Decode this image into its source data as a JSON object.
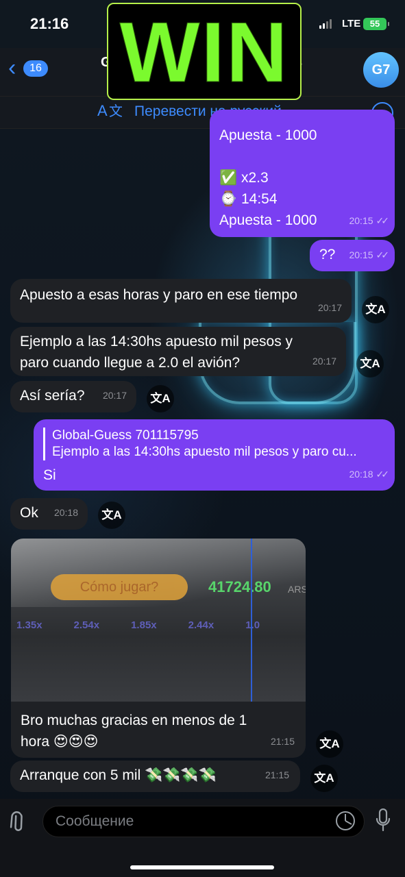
{
  "status": {
    "time": "21:16",
    "network": "LTE",
    "battery": "55"
  },
  "header": {
    "back_count": "16",
    "title_start": "G",
    "title_end": "s",
    "avatar": "G7",
    "overlay_text": "WIN"
  },
  "translate_bar": {
    "label": "Перевести на русский",
    "icon": "translate-icon"
  },
  "messages": [
    {
      "dir": "out",
      "lines": [
        "Apuesta - 1000",
        "",
        "✅ x2.3",
        "⌚ 14:54",
        "Apuesta - 1000"
      ],
      "time": "20:15"
    },
    {
      "dir": "out",
      "text": "??",
      "time": "20:15"
    },
    {
      "dir": "in",
      "text": "Apuesto a esas horas y paro en ese tiempo",
      "time": "20:17"
    },
    {
      "dir": "in",
      "text": "Ejemplo a las 14:30hs apuesto mil pesos y paro cuando llegue a 2.0 el avión?",
      "time": "20:17"
    },
    {
      "dir": "in",
      "text": "Así sería?",
      "time": "20:17"
    },
    {
      "dir": "out",
      "reply_name": "Global-Guess 701115795",
      "reply_text": "Ejemplo a las 14:30hs apuesto mil pesos y paro cu...",
      "text": "Si",
      "time": "20:18"
    },
    {
      "dir": "in",
      "text": "Ok",
      "time": "20:18"
    },
    {
      "dir": "in",
      "photo": {
        "button": "Cómo jugar?",
        "balance": "41724.80",
        "currency": "ARS",
        "multipliers": [
          "1.35x",
          "2.54x",
          "1.85x",
          "2.44x",
          "1.0"
        ]
      },
      "text": "Bro muchas gracias en menos de 1 hora 😍😍😍",
      "time": "21:15"
    },
    {
      "dir": "in",
      "text": "Arranque con 5 mil 💸💸💸💸",
      "time": "21:15"
    }
  ],
  "translate_button": "文A",
  "compose": {
    "placeholder": "Сообщение"
  },
  "colors": {
    "accent": "#3d8bfd",
    "outgoing": "#7a3ff2",
    "incoming": "#1f2125",
    "win": "#7bfa2e"
  }
}
